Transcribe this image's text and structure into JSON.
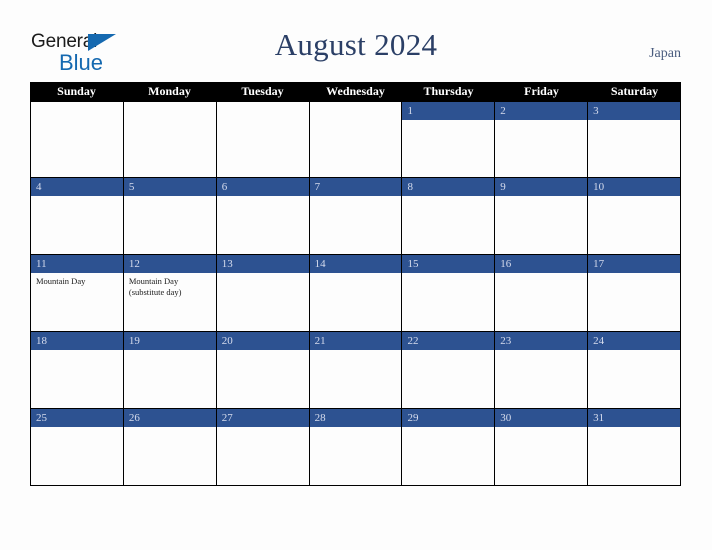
{
  "brand": {
    "name_part1": "General",
    "name_part2": "Blue",
    "triangle_color": "#1569b0"
  },
  "header": {
    "title": "August 2024",
    "country": "Japan",
    "title_color": "#2b3f66"
  },
  "calendar": {
    "month": "August",
    "year": "2024",
    "accent_color": "#2d5291",
    "header_bg": "#000000",
    "day_names": [
      "Sunday",
      "Monday",
      "Tuesday",
      "Wednesday",
      "Thursday",
      "Friday",
      "Saturday"
    ],
    "weeks": [
      [
        {
          "num": "",
          "filled": false,
          "events": []
        },
        {
          "num": "",
          "filled": false,
          "events": []
        },
        {
          "num": "",
          "filled": false,
          "events": []
        },
        {
          "num": "",
          "filled": false,
          "events": []
        },
        {
          "num": "1",
          "filled": true,
          "events": []
        },
        {
          "num": "2",
          "filled": true,
          "events": []
        },
        {
          "num": "3",
          "filled": true,
          "events": []
        }
      ],
      [
        {
          "num": "4",
          "filled": true,
          "events": []
        },
        {
          "num": "5",
          "filled": true,
          "events": []
        },
        {
          "num": "6",
          "filled": true,
          "events": []
        },
        {
          "num": "7",
          "filled": true,
          "events": []
        },
        {
          "num": "8",
          "filled": true,
          "events": []
        },
        {
          "num": "9",
          "filled": true,
          "events": []
        },
        {
          "num": "10",
          "filled": true,
          "events": []
        }
      ],
      [
        {
          "num": "11",
          "filled": true,
          "events": [
            "Mountain Day"
          ]
        },
        {
          "num": "12",
          "filled": true,
          "events": [
            "Mountain Day",
            "(substitute day)"
          ]
        },
        {
          "num": "13",
          "filled": true,
          "events": []
        },
        {
          "num": "14",
          "filled": true,
          "events": []
        },
        {
          "num": "15",
          "filled": true,
          "events": []
        },
        {
          "num": "16",
          "filled": true,
          "events": []
        },
        {
          "num": "17",
          "filled": true,
          "events": []
        }
      ],
      [
        {
          "num": "18",
          "filled": true,
          "events": []
        },
        {
          "num": "19",
          "filled": true,
          "events": []
        },
        {
          "num": "20",
          "filled": true,
          "events": []
        },
        {
          "num": "21",
          "filled": true,
          "events": []
        },
        {
          "num": "22",
          "filled": true,
          "events": []
        },
        {
          "num": "23",
          "filled": true,
          "events": []
        },
        {
          "num": "24",
          "filled": true,
          "events": []
        }
      ],
      [
        {
          "num": "25",
          "filled": true,
          "events": []
        },
        {
          "num": "26",
          "filled": true,
          "events": []
        },
        {
          "num": "27",
          "filled": true,
          "events": []
        },
        {
          "num": "28",
          "filled": true,
          "events": []
        },
        {
          "num": "29",
          "filled": true,
          "events": []
        },
        {
          "num": "30",
          "filled": true,
          "events": []
        },
        {
          "num": "31",
          "filled": true,
          "events": []
        }
      ]
    ]
  }
}
